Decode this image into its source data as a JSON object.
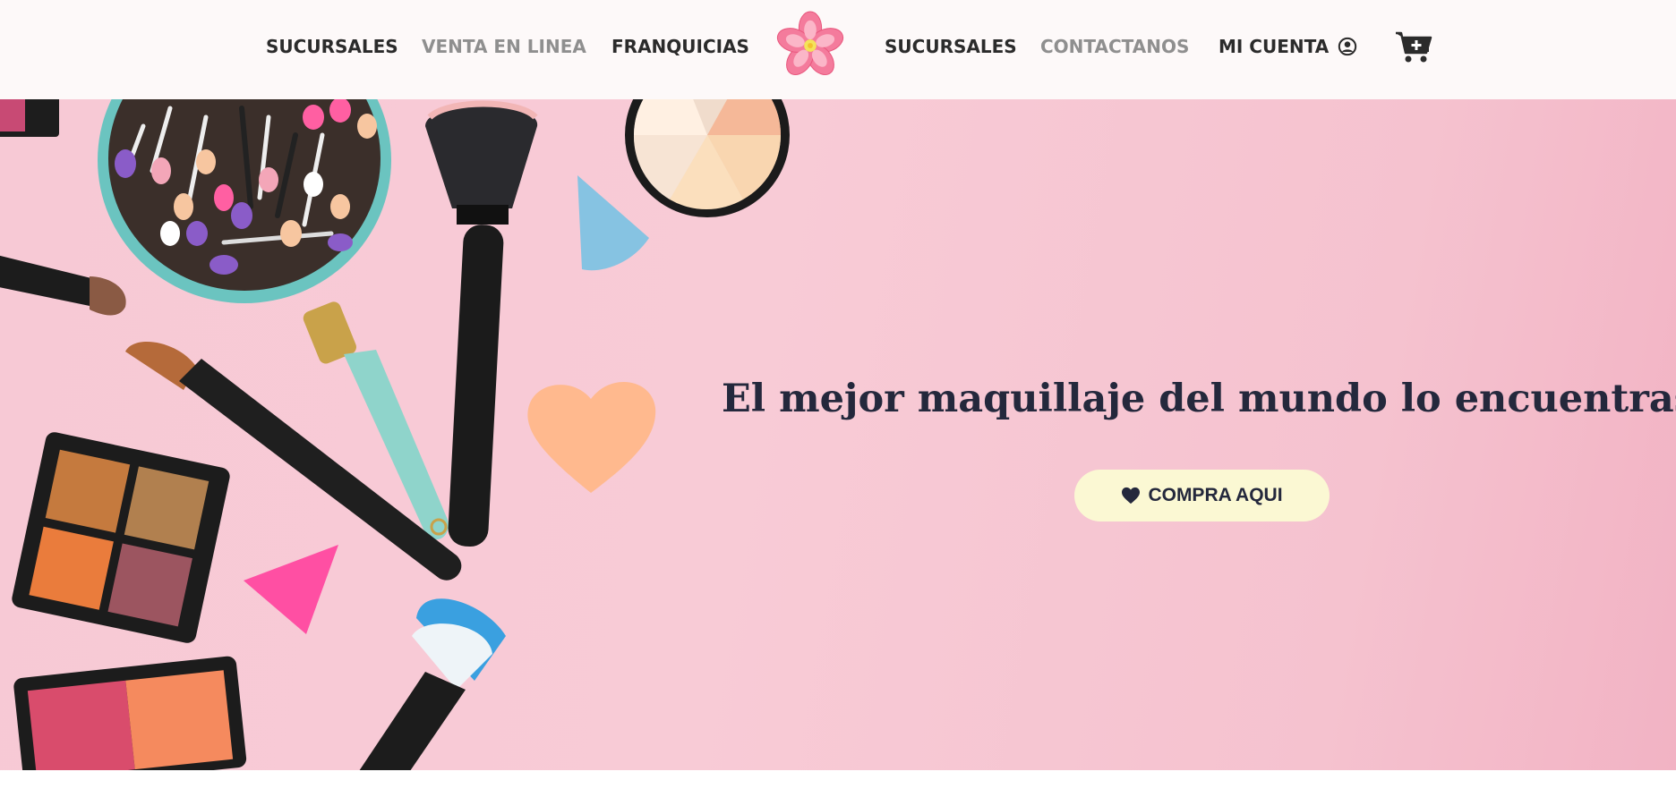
{
  "nav": {
    "items": [
      {
        "label": "SUCURSALES"
      },
      {
        "label": "VENTA EN LINEA"
      },
      {
        "label": "FRANQUICIAS"
      },
      {
        "label": "SUCURSALES"
      },
      {
        "label": "CONTACTANOS"
      },
      {
        "label": "MI CUENTA"
      }
    ],
    "logo_icon": "sakura-flower-icon",
    "account_icon": "user-circle-icon",
    "cart_icon": "cart-plus-icon"
  },
  "hero": {
    "headline": "El mejor maquillaje del mundo lo encuentras en Sakura",
    "cta_label": "COMPRA AQUI",
    "cta_icon": "heart-icon",
    "colors": {
      "background": "#f7c9d5",
      "headline": "#24283c",
      "cta_background": "#fbf8d3"
    }
  }
}
